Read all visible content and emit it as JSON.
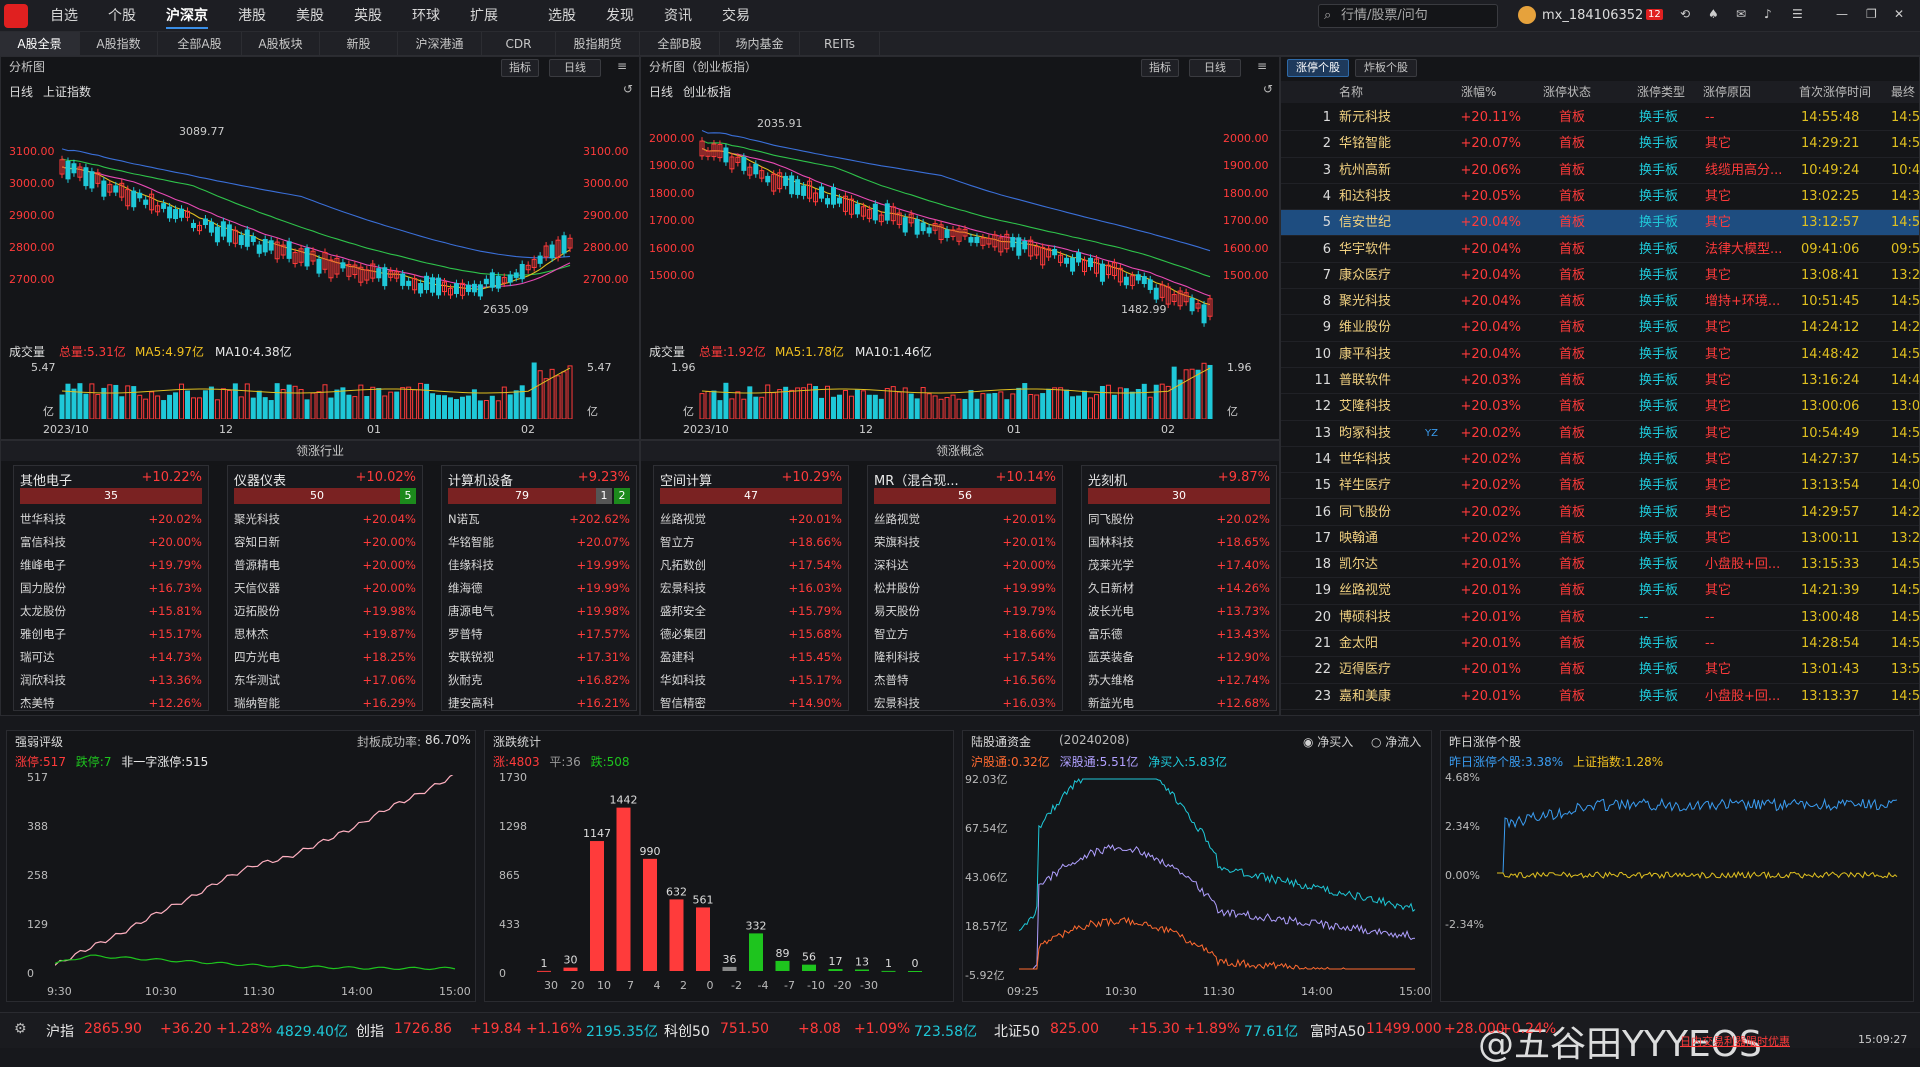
{
  "colors": {
    "up": "#ff3b3b",
    "down": "#1ec41e",
    "accent": "#3a8ee6",
    "bg": "#141518"
  },
  "topnav": {
    "items": [
      "自选",
      "个股",
      "沪深京",
      "港股",
      "美股",
      "英股",
      "环球",
      "扩展",
      "选股",
      "发现",
      "资讯",
      "交易"
    ],
    "active": "沪深京",
    "search_placeholder": "行情/股票/问句",
    "user": "mx_184106352",
    "badge": "12"
  },
  "subnav": {
    "items": [
      "A股全景",
      "A股指数",
      "全部A股",
      "A股板块",
      "新股",
      "沪深港通",
      "CDR",
      "股指期货",
      "全部B股",
      "场内基金",
      "REITs"
    ],
    "active": "A股全景"
  },
  "left_chart": {
    "header": "分析图",
    "btn_indicator": "指标",
    "btn_period": "日线",
    "label_period": "日线",
    "label_name": "上证指数",
    "yticks": [
      "3100.00",
      "3000.00",
      "2900.00",
      "2800.00",
      "2700.00"
    ],
    "high_label": "3089.77",
    "low_label": "2635.09",
    "vol_label": "成交量",
    "vol_total": "总量:5.31亿",
    "vol_ma5": "MA5:4.97亿",
    "vol_ma10": "MA10:4.38亿",
    "vol_max": "5.47",
    "vol_unit": "亿",
    "xticks": [
      "2023/10",
      "12",
      "01",
      "02"
    ]
  },
  "right_chart": {
    "header": "分析图（创业板指）",
    "btn_indicator": "指标",
    "btn_period": "日线",
    "label_period": "日线",
    "label_name": "创业板指",
    "yticks": [
      "2000.00",
      "1900.00",
      "1800.00",
      "1700.00",
      "1600.00",
      "1500.00"
    ],
    "high_label": "2035.91",
    "low_label": "1482.99",
    "vol_label": "成交量",
    "vol_total": "总量:1.92亿",
    "vol_ma5": "MA5:1.78亿",
    "vol_ma10": "MA10:1.46亿",
    "vol_max": "1.96",
    "vol_unit": "亿",
    "xticks": [
      "2023/10",
      "12",
      "01",
      "02"
    ]
  },
  "industry": {
    "title": "领涨行业",
    "sectors": [
      {
        "name": "其他电子",
        "pct": "+10.22%",
        "count": "35",
        "extra": "",
        "extra2": "",
        "stocks": [
          [
            "世华科技",
            "+20.02%"
          ],
          [
            "富信科技",
            "+20.00%"
          ],
          [
            "维峰电子",
            "+19.79%"
          ],
          [
            "国力股份",
            "+16.73%"
          ],
          [
            "太龙股份",
            "+15.81%"
          ],
          [
            "雅创电子",
            "+15.17%"
          ],
          [
            "瑞可达",
            "+14.73%"
          ],
          [
            "润欣科技",
            "+13.36%"
          ],
          [
            "杰美特",
            "+12.26%"
          ]
        ]
      },
      {
        "name": "仪器仪表",
        "pct": "+10.02%",
        "count": "50",
        "extra": "5",
        "extra2": "",
        "stocks": [
          [
            "聚光科技",
            "+20.04%"
          ],
          [
            "容知日新",
            "+20.00%"
          ],
          [
            "普源精电",
            "+20.00%"
          ],
          [
            "天信仪器",
            "+20.00%"
          ],
          [
            "迈拓股份",
            "+19.98%"
          ],
          [
            "思林杰",
            "+19.87%"
          ],
          [
            "四方光电",
            "+18.25%"
          ],
          [
            "东华测试",
            "+17.06%"
          ],
          [
            "瑞纳智能",
            "+16.29%"
          ]
        ]
      },
      {
        "name": "计算机设备",
        "pct": "+9.23%",
        "count": "79",
        "extra": "1",
        "extra2": "2",
        "stocks": [
          [
            "N诺瓦",
            "+202.62%"
          ],
          [
            "华铭智能",
            "+20.07%"
          ],
          [
            "佳缘科技",
            "+19.99%"
          ],
          [
            "维海德",
            "+19.99%"
          ],
          [
            "唐源电气",
            "+19.98%"
          ],
          [
            "罗普特",
            "+17.57%"
          ],
          [
            "安联锐视",
            "+17.31%"
          ],
          [
            "狄耐克",
            "+16.82%"
          ],
          [
            "捷安高科",
            "+16.21%"
          ]
        ]
      }
    ]
  },
  "concept": {
    "title": "领涨概念",
    "sectors": [
      {
        "name": "空间计算",
        "pct": "+10.29%",
        "count": "47",
        "extra": "",
        "extra2": "",
        "stocks": [
          [
            "丝路视觉",
            "+20.01%"
          ],
          [
            "智立方",
            "+18.66%"
          ],
          [
            "凡拓数创",
            "+17.54%"
          ],
          [
            "宏景科技",
            "+16.03%"
          ],
          [
            "盛邦安全",
            "+15.79%"
          ],
          [
            "德必集团",
            "+15.68%"
          ],
          [
            "盈建科",
            "+15.45%"
          ],
          [
            "华如科技",
            "+15.17%"
          ],
          [
            "智信精密",
            "+14.90%"
          ]
        ]
      },
      {
        "name": "MR（混合现...",
        "pct": "+10.14%",
        "count": "56",
        "extra": "",
        "extra2": "",
        "stocks": [
          [
            "丝路视觉",
            "+20.01%"
          ],
          [
            "荣旗科技",
            "+20.01%"
          ],
          [
            "深科达",
            "+20.00%"
          ],
          [
            "松井股份",
            "+19.99%"
          ],
          [
            "易天股份",
            "+19.79%"
          ],
          [
            "智立方",
            "+18.66%"
          ],
          [
            "隆利科技",
            "+17.54%"
          ],
          [
            "杰普特",
            "+16.56%"
          ],
          [
            "宏景科技",
            "+16.03%"
          ]
        ]
      },
      {
        "name": "光刻机",
        "pct": "+9.87%",
        "count": "30",
        "extra": "",
        "extra2": "",
        "stocks": [
          [
            "同飞股份",
            "+20.02%"
          ],
          [
            "国林科技",
            "+18.65%"
          ],
          [
            "茂莱光学",
            "+17.40%"
          ],
          [
            "久日新材",
            "+14.26%"
          ],
          [
            "波长光电",
            "+13.73%"
          ],
          [
            "富乐德",
            "+13.43%"
          ],
          [
            "蓝英装备",
            "+12.90%"
          ],
          [
            "苏大维格",
            "+12.74%"
          ],
          [
            "新益光电",
            "+12.68%"
          ]
        ]
      }
    ]
  },
  "limit_up": {
    "tabs": [
      "涨停个股",
      "炸板个股"
    ],
    "headers": [
      "",
      "名称",
      "涨幅%",
      "涨停状态",
      "涨停类型",
      "涨停原因",
      "首次涨停时间",
      "最终"
    ],
    "rows": [
      [
        "1",
        "新元科技",
        "+20.11%",
        "首板",
        "换手板",
        "--",
        "14:55:48",
        "14:5"
      ],
      [
        "2",
        "华铭智能",
        "+20.07%",
        "首板",
        "换手板",
        "其它",
        "14:29:21",
        "14:5"
      ],
      [
        "3",
        "杭州高新",
        "+20.06%",
        "首板",
        "换手板",
        "线缆用高分...",
        "10:49:24",
        "10:4"
      ],
      [
        "4",
        "和达科技",
        "+20.05%",
        "首板",
        "换手板",
        "其它",
        "13:02:25",
        "14:3"
      ],
      [
        "5",
        "信安世纪",
        "+20.04%",
        "首板",
        "换手板",
        "其它",
        "13:12:57",
        "14:5"
      ],
      [
        "6",
        "华宇软件",
        "+20.04%",
        "首板",
        "换手板",
        "法律大模型...",
        "09:41:06",
        "09:5"
      ],
      [
        "7",
        "康众医疗",
        "+20.04%",
        "首板",
        "换手板",
        "其它",
        "13:08:41",
        "13:2"
      ],
      [
        "8",
        "聚光科技",
        "+20.04%",
        "首板",
        "换手板",
        "增持+环境...",
        "10:51:45",
        "14:5"
      ],
      [
        "9",
        "维业股份",
        "+20.04%",
        "首板",
        "换手板",
        "其它",
        "14:24:12",
        "14:2"
      ],
      [
        "10",
        "康平科技",
        "+20.04%",
        "首板",
        "换手板",
        "其它",
        "14:48:42",
        "14:5"
      ],
      [
        "11",
        "普联软件",
        "+20.03%",
        "首板",
        "换手板",
        "其它",
        "13:16:24",
        "14:4"
      ],
      [
        "12",
        "艾隆科技",
        "+20.03%",
        "首板",
        "换手板",
        "其它",
        "13:00:06",
        "13:0"
      ],
      [
        "13",
        "昀冢科技",
        "+20.02%",
        "首板",
        "换手板",
        "其它",
        "10:54:49",
        "14:5"
      ],
      [
        "14",
        "世华科技",
        "+20.02%",
        "首板",
        "换手板",
        "其它",
        "14:27:37",
        "14:5"
      ],
      [
        "15",
        "祥生医疗",
        "+20.02%",
        "首板",
        "换手板",
        "其它",
        "13:13:54",
        "14:0"
      ],
      [
        "16",
        "同飞股份",
        "+20.02%",
        "首板",
        "换手板",
        "其它",
        "14:29:57",
        "14:2"
      ],
      [
        "17",
        "映翰通",
        "+20.02%",
        "首板",
        "换手板",
        "其它",
        "13:00:11",
        "13:2"
      ],
      [
        "18",
        "凯尔达",
        "+20.01%",
        "首板",
        "换手板",
        "小盘股+回...",
        "13:15:33",
        "14:5"
      ],
      [
        "19",
        "丝路视觉",
        "+20.01%",
        "首板",
        "换手板",
        "其它",
        "14:21:39",
        "14:5"
      ],
      [
        "20",
        "博硕科技",
        "+20.01%",
        "首板",
        "--",
        "--",
        "13:00:48",
        "14:5"
      ],
      [
        "21",
        "金太阳",
        "+20.01%",
        "首板",
        "换手板",
        "--",
        "14:28:54",
        "14:5"
      ],
      [
        "22",
        "迈得医疗",
        "+20.01%",
        "首板",
        "换手板",
        "其它",
        "13:01:43",
        "13:5"
      ],
      [
        "23",
        "嘉和美康",
        "+20.01%",
        "首板",
        "换手板",
        "小盘股+回...",
        "13:13:37",
        "14:5"
      ]
    ],
    "selected_row": "5",
    "yz_tag": "YZ"
  },
  "panel_strength": {
    "title": "强弱评级",
    "success_label": "封板成功率:",
    "success": "86.70%",
    "leg_up": "涨停:",
    "up": "517",
    "leg_down": "跌停:",
    "down": "7",
    "leg_nonone": "非一字涨停:",
    "nonone": "515",
    "yticks": [
      "517",
      "388",
      "258",
      "129",
      "0"
    ],
    "xticks": [
      "9:30",
      "10:30",
      "11:30",
      "14:00",
      "15:00"
    ]
  },
  "panel_dist": {
    "title": "涨跌统计",
    "leg_up": "涨:",
    "up": "4803",
    "leg_flat": "平:",
    "flat": "36",
    "leg_down": "跌:",
    "down": "508",
    "yticks": [
      "1730",
      "1298",
      "865",
      "433",
      "0"
    ]
  },
  "panel_hk": {
    "title": "陆股通资金",
    "date": "(20240208)",
    "radio1": "净买入",
    "radio2": "净流入",
    "leg_sh": "沪股通:",
    "sh": "0.32亿",
    "leg_sz": "深股通:",
    "sz": "5.51亿",
    "leg_net": "净买入:",
    "net": "5.83亿",
    "yticks": [
      "92.03亿",
      "67.54亿",
      "43.06亿",
      "18.57亿",
      "-5.92亿"
    ],
    "xticks": [
      "09:25",
      "10:30",
      "11:30",
      "14:00",
      "15:00"
    ]
  },
  "panel_yday": {
    "title": "昨日涨停个股",
    "leg_a": "昨日涨停个股:",
    "a": "3.38%",
    "leg_b": "上证指数:",
    "b": "1.28%",
    "yticks": [
      "4.68%",
      "2.34%",
      "0.00%",
      "-2.34%"
    ]
  },
  "chart_data": [
    {
      "type": "bar",
      "title": "涨跌统计",
      "categories": [
        "30",
        "20",
        "10",
        "7",
        "4",
        "2",
        "0",
        "-2",
        "-4",
        "-7",
        "-10",
        "-20",
        "-30"
      ],
      "values": [
        1,
        30,
        1147,
        1442,
        990,
        632,
        561,
        36,
        332,
        89,
        56,
        17,
        13,
        1,
        0
      ],
      "ylim": [
        0,
        1730
      ]
    },
    {
      "type": "line",
      "title": "强弱评级",
      "series": [
        {
          "name": "涨停",
          "values": [
            15,
            60,
            100,
            150,
            190,
            240,
            280,
            300,
            340,
            380,
            430,
            470,
            517
          ]
        },
        {
          "name": "跌停",
          "values": [
            20,
            40,
            35,
            30,
            25,
            20,
            15,
            12,
            10,
            8,
            7,
            7,
            7
          ]
        }
      ],
      "ylim": [
        0,
        517
      ]
    }
  ],
  "footer": {
    "items": [
      {
        "name": "沪指",
        "price": "2865.90",
        "chg": "+36.20",
        "pct": "+1.28%",
        "amt": "4829.40亿"
      },
      {
        "name": "创指",
        "price": "1726.86",
        "chg": "+19.84",
        "pct": "+1.16%",
        "amt": "2195.35亿"
      },
      {
        "name": "科创50",
        "price": "751.50",
        "chg": "+8.08",
        "pct": "+1.09%",
        "amt": "723.58亿"
      },
      {
        "name": "北证50",
        "price": "825.00",
        "chg": "+15.30",
        "pct": "+1.89%",
        "amt": "77.61亿"
      },
      {
        "name": "富时A50",
        "price": "11499.000",
        "chg": "+28.000",
        "pct": "+0.24%",
        "amt": ""
      }
    ],
    "promo": "日内交易利器限时优惠",
    "time": "15:09:27",
    "watermark": "@五谷田YYYEOS"
  }
}
